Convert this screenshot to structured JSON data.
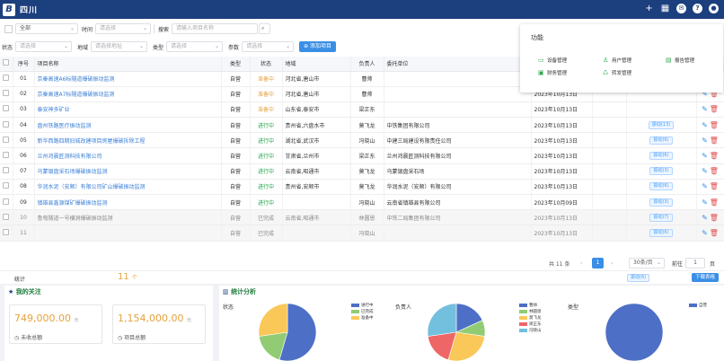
{
  "header": {
    "logo_letter": "B",
    "title": "四川"
  },
  "filters": {
    "row1": [
      {
        "label": "",
        "value": "全部"
      },
      {
        "label": "时间",
        "placeholder": "请选择"
      },
      {
        "label": "搜索",
        "placeholder": "请输入项目名称"
      }
    ],
    "row2": [
      {
        "label": "状态",
        "placeholder": "请选择"
      },
      {
        "label": "地域",
        "placeholder": "请选择地址"
      },
      {
        "label": "类型",
        "placeholder": "请选择"
      },
      {
        "label": "参数",
        "placeholder": "请选择"
      }
    ],
    "add_button": "添加项目"
  },
  "table": {
    "columns": [
      "序号",
      "项目名称",
      "类型",
      "状态",
      "地域",
      "负责人",
      "委托单位"
    ],
    "rows": [
      {
        "no": "01",
        "name": "京秦高速A6标隧道爆破振动监测",
        "type": "自营",
        "status": "准备中",
        "region": "河北省,唐山市",
        "owner": "曹帅",
        "client": "",
        "date": "2023年10月13日",
        "tag": ""
      },
      {
        "no": "02",
        "name": "京秦高速A7标隧道爆破振动监测",
        "type": "自营",
        "status": "准备中",
        "region": "河北省,唐山市",
        "owner": "曹帅",
        "client": "",
        "date": "2023年10月13日",
        "tag": ""
      },
      {
        "no": "03",
        "name": "泰安神多矿业",
        "type": "自营",
        "status": "准备中",
        "region": "山东省,泰安市",
        "owner": "梁正东",
        "client": "",
        "date": "2023年10月13日",
        "tag": ""
      },
      {
        "no": "04",
        "name": "盘州铁路医疗振动监测",
        "type": "自营",
        "status": "进行中",
        "region": "贵州省,六盘水市",
        "owner": "莫飞龙",
        "client": "中铁集团有限公司",
        "date": "2023年10月13日",
        "tag": "振动(13)"
      },
      {
        "no": "05",
        "name": "新华西路四期旧城改建项目房屋爆破拆除工程",
        "type": "自营",
        "status": "进行中",
        "region": "湖北省,武汉市",
        "owner": "冯晓山",
        "client": "中建三局建设有限责任公司",
        "date": "2023年10月13日",
        "tag": "振动(6)"
      },
      {
        "no": "06",
        "name": "兰州鸿晨匠测科技有限公司",
        "type": "自营",
        "status": "进行中",
        "region": "甘肃省,兰州市",
        "owner": "梁正东",
        "client": "兰州鸿晨匠测科技有限公司",
        "date": "2023年10月13日",
        "tag": "振动(6)"
      },
      {
        "no": "07",
        "name": "乌蒙银盘采石场爆破振动监测",
        "type": "自营",
        "status": "进行中",
        "region": "云南省,昭通市",
        "owner": "莫飞龙",
        "client": "乌蒙银盘采石场",
        "date": "2023年10月13日",
        "tag": "振动(3)"
      },
      {
        "no": "08",
        "name": "华润水泥（安顺）有限公司矿山爆破振动监测",
        "type": "自营",
        "status": "进行中",
        "region": "贵州省,安顺市",
        "owner": "莫飞龙",
        "client": "华润水泥（安顺）有限公司",
        "date": "2023年10月13日",
        "tag": "振动(6)"
      },
      {
        "no": "09",
        "name": "镇雄县鑫源煤矿爆破振动监测",
        "type": "自营",
        "status": "进行中",
        "region": "",
        "owner": "冯晓山",
        "client": "云南省镇雄县有限公司",
        "date": "2023年10月09日",
        "tag": "振动(3)"
      },
      {
        "no": "10",
        "name": "鲁甸隧道一号横洞爆破振动监测",
        "type": "自营",
        "status": "已完成",
        "region": "云南省,昭通市",
        "owner": "林圆恩",
        "client": "中铁二局集团有限公司",
        "date": "2023年10月13日",
        "tag": "振动(7)"
      },
      {
        "no": "11",
        "name": "",
        "type": "自营",
        "status": "已完成",
        "region": "",
        "owner": "冯晓山",
        "client": "",
        "date": "2023年10月13日",
        "tag": "振动(6)"
      }
    ]
  },
  "pager": {
    "total": "共 11 条",
    "current": "1",
    "size": "30条/页",
    "goto_label": "前往",
    "goto_value": "1",
    "page_unit": "页"
  },
  "stats": {
    "label": "统计",
    "count": "11",
    "count_unit": "个",
    "tag": "振动(6)",
    "download": "下载表格"
  },
  "popup": {
    "title": "功能",
    "items": [
      {
        "label": "设备管理",
        "icon": "device-icon"
      },
      {
        "label": "用户管理",
        "icon": "user-icon"
      },
      {
        "label": "报告管理",
        "icon": "report-icon"
      },
      {
        "label": "财务管理",
        "icon": "finance-icon"
      },
      {
        "label": "转发管理",
        "icon": "forward-icon"
      }
    ]
  },
  "focus": {
    "title": "我的关注",
    "cards": [
      {
        "value": "749,000.00",
        "unit": "元",
        "label": "未收总额"
      },
      {
        "value": "1,154,000.00",
        "unit": "元",
        "label": "项目总额"
      }
    ]
  },
  "analysis": {
    "title": "统计分析"
  },
  "chart_data": [
    {
      "type": "pie",
      "title": "状态",
      "categories": [
        "进行中",
        "已完成",
        "准备中"
      ],
      "values": [
        6,
        2,
        3
      ],
      "colors": [
        "#4e6fc6",
        "#91cc75",
        "#fac858"
      ],
      "legend": "top-right"
    },
    {
      "type": "pie",
      "title": "负责人",
      "categories": [
        "曹帅",
        "林圆恩",
        "莫飞龙",
        "梁正东",
        "冯晓山"
      ],
      "values": [
        2,
        1,
        3,
        2,
        3
      ],
      "colors": [
        "#4e6fc6",
        "#91cc75",
        "#fac858",
        "#ee6666",
        "#73c0de"
      ],
      "legend": "top-right"
    },
    {
      "type": "pie",
      "title": "类型",
      "categories": [
        "自营"
      ],
      "values": [
        11
      ],
      "colors": [
        "#4e6fc6"
      ],
      "legend": "top-right"
    }
  ]
}
